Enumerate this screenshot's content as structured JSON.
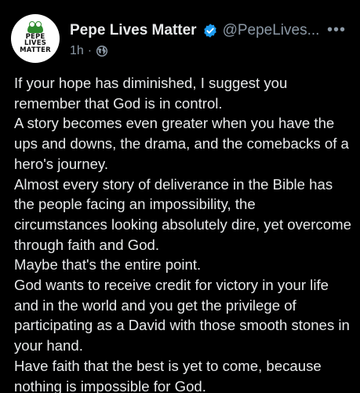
{
  "post": {
    "author_name": "Pepe Lives Matter",
    "author_handle": "@PepeLives...",
    "avatar_text": [
      "PEPE",
      "LIVES",
      "MATTER"
    ],
    "timestamp": "1h",
    "separator": "·",
    "more_label": "•••",
    "paragraphs": [
      "If your hope has diminished, I suggest you remember that God is in control.",
      "A story becomes even greater when you have the ups and downs, the drama, and the comebacks of a hero's journey.",
      "Almost every story of deliverance in the Bible has the people facing an impossibility, the circumstances looking absolutely dire, yet overcome through faith and God.",
      "Maybe that's the entire point.",
      "God wants to receive credit for victory in your life and in the world and you get the privilege of participating as a David with those smooth stones in your hand.",
      "Have faith that the best is yet to come, because nothing is impossible for God."
    ]
  },
  "icons": {
    "verified": "verified-badge-icon",
    "visibility": "globe-icon",
    "more": "more-options-icon"
  },
  "colors": {
    "background": "#000000",
    "text": "#e7e9ea",
    "secondary_text": "#8b98a5",
    "verified": "#1d9bf0"
  }
}
